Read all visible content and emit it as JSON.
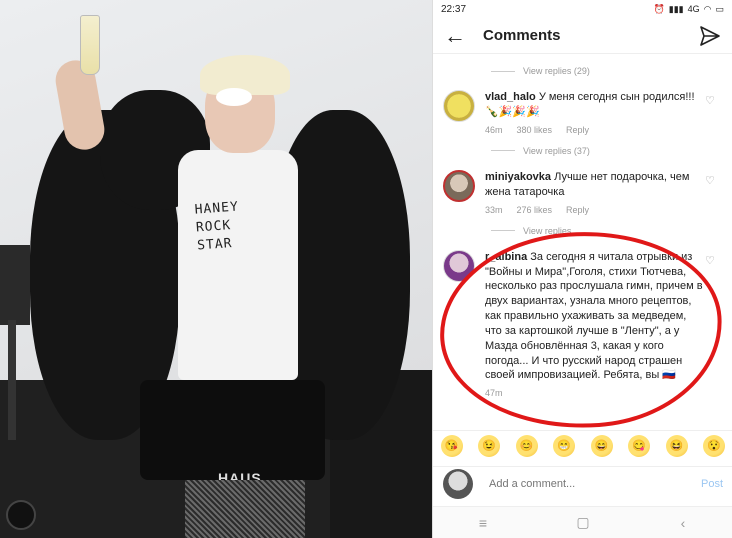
{
  "status_bar": {
    "time": "22:37",
    "network": "4G"
  },
  "header": {
    "title": "Comments"
  },
  "view_replies": [
    "View replies (29)",
    "View replies (37)",
    "View replies"
  ],
  "comments": [
    {
      "username": "vlad_halo",
      "text": "У меня сегодня сын родился!!! 🍾🎉🎉🎉",
      "time": "46m",
      "likes": "380 likes",
      "reply": "Reply"
    },
    {
      "username": "miniyakovka",
      "text": "Лучше нет подарочка, чем жена татарочка",
      "time": "33m",
      "likes": "276 likes",
      "reply": "Reply"
    },
    {
      "username": "r_albina",
      "text": "За сегодня я читала отрывки из \"Войны и Мира\",Гоголя, стихи Тютчева, несколько раз прослушала гимн, причем в двух вариантах, узнала много рецептов, как правильно ухаживать за медведем, что за картошкой лучше в \"Ленту\", а у Мазда обновлённая 3, какая у кого погода... И что русский народ страшен своей импровизацией. Ребята, вы 🇷🇺",
      "time": "47m"
    }
  ],
  "emojis": [
    "😘",
    "😉",
    "😊",
    "😁",
    "😄",
    "😋",
    "😆",
    "😯"
  ],
  "add_comment": {
    "placeholder": "Add a comment...",
    "post_label": "Post"
  },
  "photo": {
    "shirt_text": "HANEY\nROCK\nSTAR",
    "brand": "HAUS"
  },
  "colors": {
    "annotation": "#e01818",
    "post_button": "#9cc7f2"
  },
  "icons": {
    "back": "arrow-left-icon",
    "send": "paper-plane-icon",
    "heart": "heart-icon",
    "nav": [
      "menu-icon",
      "square-icon",
      "back-chevron-icon"
    ]
  }
}
